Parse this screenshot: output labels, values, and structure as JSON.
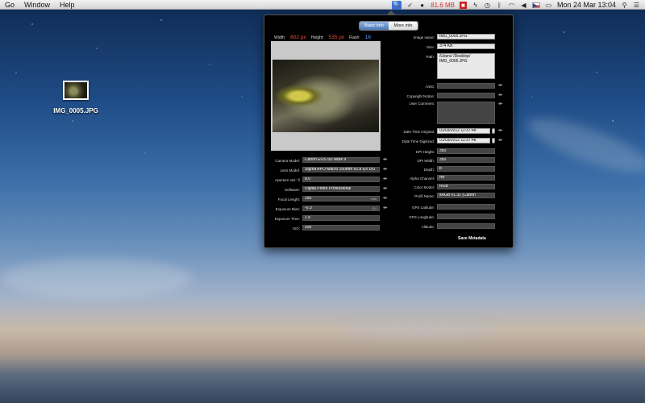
{
  "menubar": {
    "items": [
      "Go",
      "Window",
      "Help"
    ],
    "memory": "81.6 MB",
    "datetime": "Mon 24 Mar  13:04"
  },
  "desktop": {
    "file_label": "IMG_0005.JPG"
  },
  "panel": {
    "tabs": [
      "Basic info",
      "More info"
    ],
    "dims": {
      "width_label": "Width:",
      "width_value": "802 px",
      "height_label": "Height:",
      "height_value": "535 px",
      "flash_label": "Flash:",
      "flash_value": "16"
    },
    "left_fields": [
      {
        "label": "Camera Model:",
        "value": "Canon EOS 5D Mark II",
        "unit": ""
      },
      {
        "label": "Lens Model:",
        "value": "Sigma APO Macro 150mm f/2.8 EX DG",
        "unit": ""
      },
      {
        "label": "Aperture Val.: f/",
        "value": "8.0",
        "unit": ""
      },
      {
        "label": "Software:",
        "value": "Digital Photo Professional",
        "unit": ""
      },
      {
        "label": "Focal Lenght:",
        "value": "150",
        "unit": "mm"
      },
      {
        "label": "Exposure Bias:",
        "value": "-0.3",
        "unit": "EV"
      },
      {
        "label": "Exposure Time:",
        "value": "1 s",
        "unit": ""
      },
      {
        "label": "ISO:",
        "value": "200",
        "unit": ""
      }
    ],
    "right": {
      "image_name_label": "Image name:",
      "image_name": "IMG_0005.JPG",
      "size_label": "Size:",
      "size": "374 KB",
      "path_label": "Path:",
      "path_line1": "/Users/         /Desktop/",
      "path_line2": "IMG_0005.JPG",
      "artist_label": "Artist:",
      "artist": "",
      "copyright_label": "Copyright Notice:",
      "copyright": "",
      "comment_label": "User Comment:",
      "comment": "",
      "dto_label": "Date Time Original:",
      "dto": "01/03/2012 11:37:48",
      "dtd_label": "Date Time Digitized:",
      "dtd": "01/03/2012 11:37:48",
      "lower_fields": [
        {
          "label": "DPI Height:",
          "value": "350"
        },
        {
          "label": "DPI Width:",
          "value": "350"
        },
        {
          "label": "Depth:",
          "value": "8"
        },
        {
          "label": "Alpha Channel:",
          "value": "No"
        },
        {
          "label": "Color Model:",
          "value": "RGB"
        },
        {
          "label": "Profil Name:",
          "value": "sRGB v1.31 (Canon"
        }
      ],
      "gps_fields": [
        {
          "label": "GPS Latitude:",
          "value": ""
        },
        {
          "label": "GPS Longitude:",
          "value": ""
        },
        {
          "label": "Altitude:",
          "value": ""
        }
      ]
    },
    "save_label": "Save Metadata"
  }
}
